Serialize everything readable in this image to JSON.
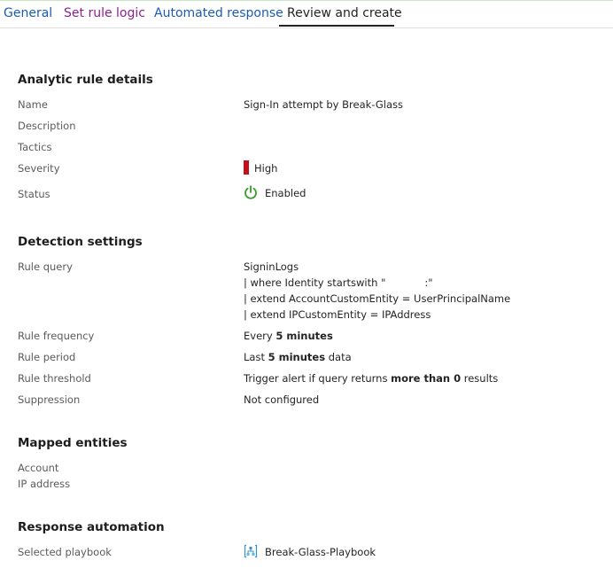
{
  "tabs": [
    {
      "label": "General"
    },
    {
      "label": "Set rule logic"
    },
    {
      "label": "Automated response"
    },
    {
      "label": "Review and create"
    }
  ],
  "analytic": {
    "title": "Analytic rule details",
    "name_label": "Name",
    "name_value": "Sign-In attempt by Break-Glass",
    "description_label": "Description",
    "tactics_label": "Tactics",
    "severity_label": "Severity",
    "severity_value": "High",
    "severity_color": "#c50f1f",
    "status_label": "Status",
    "status_value": "Enabled",
    "status_icon": "power-icon",
    "status_color": "#3a9b2a"
  },
  "detection": {
    "title": "Detection settings",
    "query_label": "Rule query",
    "query_line1": "SigninLogs",
    "query_line2_prefix": "| where Identity startswith \"",
    "query_line2_suffix": ":\"",
    "query_line3": "| extend AccountCustomEntity = UserPrincipalName",
    "query_line4": "| extend IPCustomEntity = IPAddress",
    "frequency_label": "Rule frequency",
    "frequency_prefix": "Every ",
    "frequency_bold": "5 minutes",
    "period_label": "Rule period",
    "period_prefix": "Last ",
    "period_bold": "5 minutes",
    "period_suffix": " data",
    "threshold_label": "Rule threshold",
    "threshold_prefix": "Trigger alert if query returns ",
    "threshold_bold": "more than 0",
    "threshold_suffix": " results",
    "suppression_label": "Suppression",
    "suppression_value": "Not configured"
  },
  "entities": {
    "title": "Mapped entities",
    "account_label": "Account",
    "ip_label": "IP address"
  },
  "response": {
    "title": "Response automation",
    "playbook_label": "Selected playbook",
    "playbook_value": "Break-Glass-Playbook",
    "playbook_icon": "logic-app-icon"
  }
}
